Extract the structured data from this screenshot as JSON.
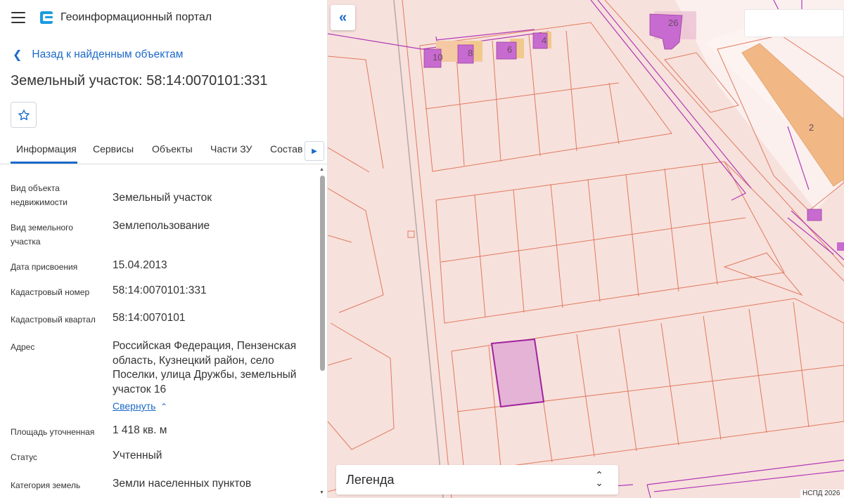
{
  "header": {
    "portal_title": "Геоинформационный портал"
  },
  "nav": {
    "back_label": "Назад к найденным объектам"
  },
  "object": {
    "title": "Земельный участок: 58:14:0070101:331"
  },
  "tabs": [
    {
      "label": "Информация",
      "active": true
    },
    {
      "label": "Сервисы"
    },
    {
      "label": "Объекты"
    },
    {
      "label": "Части ЗУ"
    },
    {
      "label": "Состав"
    }
  ],
  "properties": [
    {
      "label": "Вид объекта недвижимости",
      "value": "Земельный участок"
    },
    {
      "label": "Вид земельного участка",
      "value": "Землепользование"
    },
    {
      "label": "Дата присвоения",
      "value": "15.04.2013"
    },
    {
      "label": "Кадастровый номер",
      "value": "58:14:0070101:331"
    },
    {
      "label": "Кадастровый квартал",
      "value": "58:14:0070101"
    },
    {
      "label": "Адрес",
      "value": "Российская Федерация, Пензенская область, Кузнецкий район, село Поселки, улица Дружбы, земельный участок 16"
    },
    {
      "label": "Площадь уточненная",
      "value": "1 418 кв. м"
    },
    {
      "label": "Статус",
      "value": "Учтенный"
    },
    {
      "label": "Категория земель",
      "value": "Земли населенных пунктов"
    }
  ],
  "address_toggle_label": "Свернуть",
  "map": {
    "legend_label": "Легенда",
    "copyright": "НСПД 2026",
    "house_numbers": [
      "10",
      "8",
      "6",
      "4",
      "26",
      "2"
    ],
    "colors": {
      "background": "#f7e1dc",
      "parcel_line": "#e07a5f",
      "boundary_line": "#b23ab8",
      "selected_fill": "#e4b3d6",
      "building_fill": "#c86bd0",
      "building_orange": "#f0b27a"
    }
  },
  "icons": {
    "menu": "hamburger-icon",
    "logo": "portal-logo-icon",
    "back": "chevron-left-icon",
    "favorite": "star-icon",
    "tabs_next": "caret-right-icon",
    "collapse_panel": "double-chevron-left-icon",
    "legend_toggle": "chevron-up-down-icon"
  },
  "accent_color": "#1b6ac9"
}
